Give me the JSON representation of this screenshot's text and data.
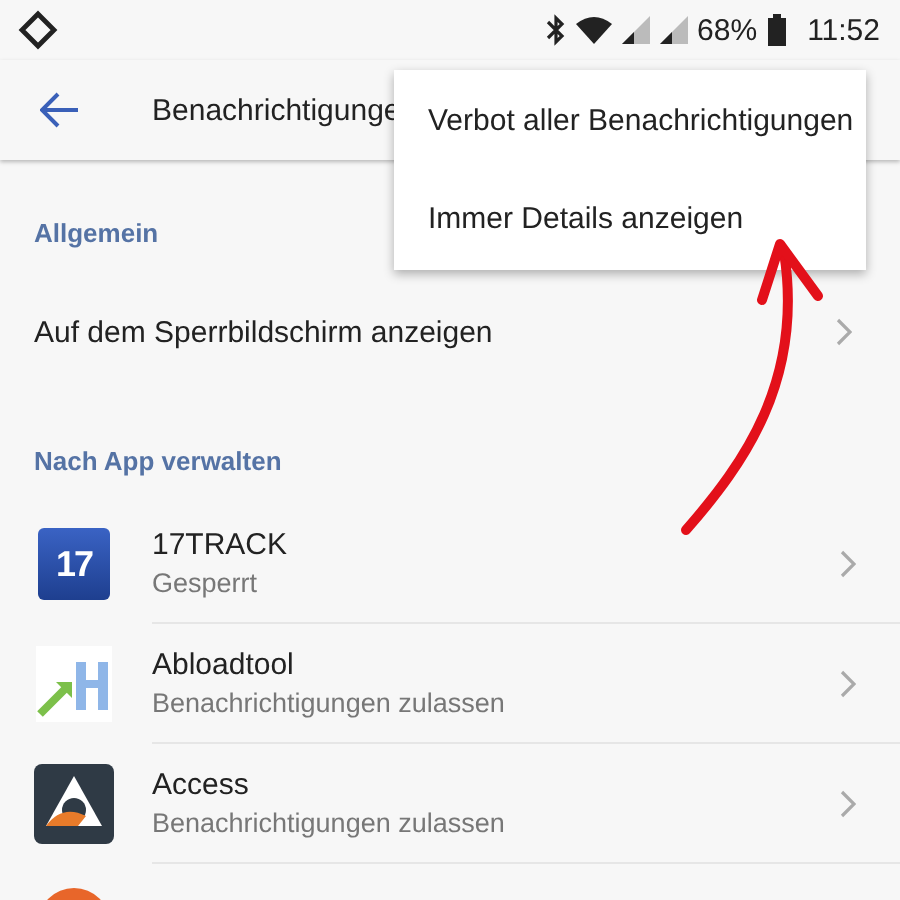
{
  "status_bar": {
    "battery": "68%",
    "time": "11:52"
  },
  "toolbar": {
    "title": "Benachrichtigunge"
  },
  "menu": {
    "items": [
      {
        "label": "Verbot aller Benachrichtigungen"
      },
      {
        "label": "Immer Details anzeigen"
      }
    ]
  },
  "sections": [
    {
      "header": "Allgemein",
      "rows": [
        {
          "kind": "setting",
          "title": "Auf dem Sperrbildschirm anzeigen"
        }
      ]
    },
    {
      "header": "Nach App verwalten",
      "rows": [
        {
          "kind": "app",
          "icon_text": "17",
          "title": "17TRACK",
          "subtitle": "Gesperrt"
        },
        {
          "kind": "app",
          "title": "Abloadtool",
          "subtitle": "Benachrichtigungen zulassen"
        },
        {
          "kind": "app",
          "title": "Access",
          "subtitle": "Benachrichtigungen zulassen"
        },
        {
          "kind": "app"
        }
      ]
    }
  ]
}
